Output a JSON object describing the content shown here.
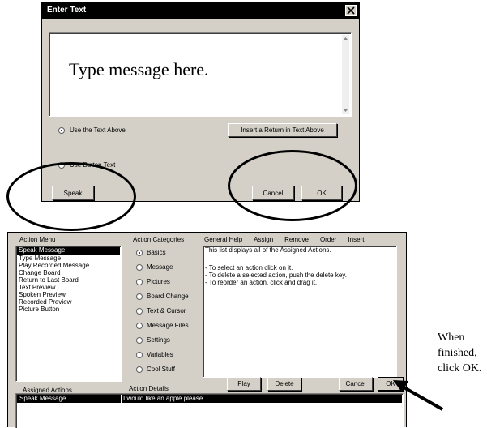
{
  "dialog": {
    "title": "Enter Text",
    "message_text": "Type message here.",
    "radio_text_above": "Use the Text Above",
    "insert_return_label": "Insert a Return in Text Above",
    "radio_button_text": "Use Button Text",
    "speak_label": "Speak",
    "cancel_label": "Cancel",
    "ok_label": "OK"
  },
  "action_window": {
    "action_menu_header": "Action Menu",
    "action_menu_items": [
      "Speak Message",
      "Type Message",
      "Play Recorded Message",
      "Change Board",
      "Return to Last Board",
      "Text Preview",
      "Spoken Preview",
      "Recorded Preview",
      "Picture Button"
    ],
    "selected_action_index": 0,
    "categories_header": "Action Categories",
    "categories": [
      "Basics",
      "Message",
      "Pictures",
      "Board Change",
      "Text & Cursor",
      "Message Files",
      "Settings",
      "Variables",
      "Cool Stuff"
    ],
    "selected_category_index": 0,
    "top_menu": [
      "General Help",
      "Assign",
      "Remove",
      "Order",
      "Insert"
    ],
    "help_lines": [
      "This list displays all of the Assigned Actions.",
      "",
      "- To select an action click on it.",
      "- To delete a selected action, push the delete key.",
      "- To reorder an action, click and drag it."
    ],
    "assigned_header": "Assigned Actions",
    "details_header": "Action Details",
    "play_label": "Play",
    "delete_label": "Delete",
    "cancel_label": "Cancel",
    "ok_label": "OK",
    "assigned_row_action": "Speak Message",
    "assigned_row_detail": "I would like an apple please"
  },
  "annotation": {
    "line1": "When",
    "line2": "finished,",
    "line3": "click OK."
  }
}
